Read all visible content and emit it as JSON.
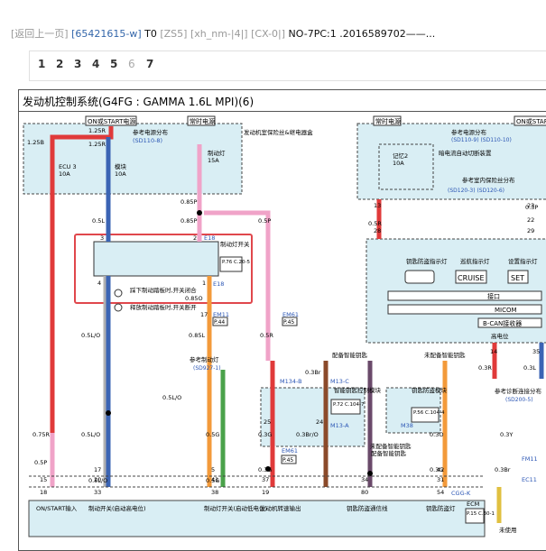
{
  "header": {
    "back_link": "[返回上一页]",
    "doc_code": "[65421615-w]",
    "t0": "T0",
    "tag1": "[ZS5]",
    "tag2": "[xh_nm-|4|]",
    "tag3": "[CX-0|]",
    "tail": "NO-7PC:1 .2016589702——..."
  },
  "pager": {
    "pages": [
      "1",
      "2",
      "3",
      "4",
      "5",
      "6",
      "7"
    ],
    "current": "6"
  },
  "diagram": {
    "title": "发动机控制系统(G4FG : GAMMA 1.6L MPI)(6)",
    "power": {
      "on_start": "ON或START电源",
      "normal": "常时电源",
      "normal2": "常时电源",
      "on_start_r": "ON或START电源"
    },
    "fuses": {
      "ecu3": "ECU 3",
      "ecu3_a": "10A",
      "module": "模块",
      "module_a": "10A",
      "stop": "制动灯",
      "stop_a": "15A",
      "memory": "记忆2",
      "memory_a": "10A"
    },
    "notes": {
      "ref_power": "参考电源分布",
      "ref_power_code": "(SD110-8)",
      "engine_room": "发动机室保险丝&继电器盒",
      "ref_power_r": "参考电源分布",
      "ref_power_r_codes": "(SD110-9)  (SD110-10)",
      "dark_current": "暗电流自动切断装置",
      "interior": "参考室内保险丝分布",
      "interior_codes": "(SD120-3)  (SD120-6)",
      "stop_lamp_ref": "参考制动灯",
      "stop_lamp_code": "(SD927-1)",
      "diag_ref": "参考诊断连接分布",
      "diag_code": "(SD200-5)",
      "legend1": "踩下制动踏板时,开关闭合",
      "legend2": "释放制动踏板时,开关断开",
      "with_key": "配备智能钥匙",
      "without_key": "未配备智能钥匙",
      "without_key2": "未配备智能钥匙",
      "with_key2": "配备智能钥匙",
      "unused": "未使用"
    },
    "switch": {
      "label": "制动灯开关",
      "conn": "E18",
      "conn2": "E18",
      "pages": "P.76  C.20-5"
    },
    "cluster": {
      "immo": "钥匙防盗指示灯",
      "cruise": "巡航指示灯",
      "set": "设置指示灯",
      "cruise_txt": "CRUISE",
      "set_txt": "SET",
      "iface": "接口",
      "micom": "MICOM",
      "bcan": "B-CAN接收器",
      "high": "高电位"
    },
    "modules": {
      "smart": "智能钥匙控制模块",
      "smart_ref": "P.72  C.104-7",
      "immo": "钥匙防盗模块",
      "immo_ref": "P.56  C.104-4"
    },
    "conns": {
      "em61": "EM61",
      "em61_p": "P.45",
      "em11": "EM11",
      "em11_p": "P.44",
      "m134b": "M134-B",
      "m13c": "M13-C",
      "m13a": "M13-A",
      "m38": "M38",
      "em61b": "EM61",
      "em61b_p": "P.45",
      "fm11": "FM11",
      "ec11": "EC11",
      "cggk": "CGG-K",
      "ecm": "ECM",
      "ecm_p": "P.15  C.30-1"
    },
    "wires": {
      "w1": "1.25R",
      "w2": "1.25R",
      "w3": "1.25B",
      "w4": "0.85P",
      "w5": "0.5L",
      "w6": "0.85P",
      "w7": "0.5P",
      "w8": "0.85O",
      "w9": "0.5L/O",
      "w10": "0.85L",
      "w11": "0.5R",
      "w12": "0.75R",
      "w13": "0.5L/O",
      "w14": "0.5G",
      "w15": "0.3G",
      "w16": "0.3Br/O",
      "w17": "0.3O",
      "w18": "0.3G",
      "w19": "0.5P",
      "w20": "0.5L/O",
      "w21": "0.5G",
      "w22": "0.3Br",
      "w23": "0.5R",
      "w24": "0.3R",
      "w25": "0.3L",
      "w26": "0.3Y",
      "w27": "0.3Br",
      "w28": "0.3P",
      "w29": "0.3G",
      "w30": "0.5L/O"
    },
    "pins": {
      "p13": "13",
      "p28": "28",
      "p23": "23",
      "p22": "22",
      "p29": "29",
      "p3": "3",
      "p2": "2",
      "p4": "4",
      "p1": "1",
      "p17": "17",
      "p15": "15",
      "p17b": "17",
      "p18": "18",
      "p20": "20",
      "p33": "33",
      "p38": "38",
      "p41": "41",
      "p5": "5",
      "p24": "24",
      "p37": "37",
      "p19": "19",
      "p25": "25",
      "p34": "34",
      "p80": "80",
      "p54": "54",
      "p31": "31",
      "p42": "42",
      "p14": "14",
      "p35": "35"
    },
    "ecm_labels": {
      "l1": "ON/START输入",
      "l2": "制动开关(启动高电位)",
      "l3": "制动灯开关(启动低电位)",
      "l4": "发动机转速输出",
      "l5": "钥匙防盗通信线",
      "l6": "钥匙防盗灯"
    }
  }
}
